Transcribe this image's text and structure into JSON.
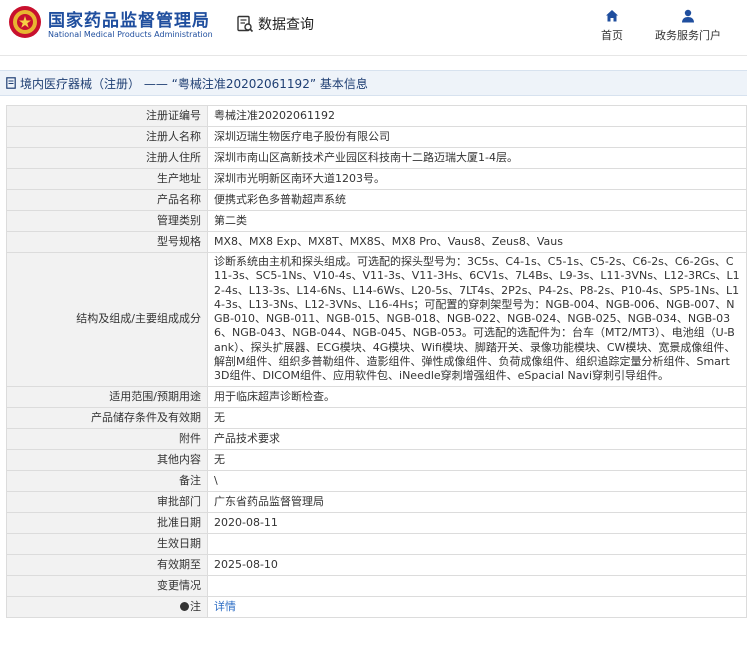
{
  "site": {
    "name_cn": "国家药品监督管理局",
    "name_en": "National Medical Products Administration",
    "query_label": "数据查询",
    "nav_home": "首页",
    "nav_gov": "政务服务门户"
  },
  "breadcrumb": "境内医疗器械（注册） —— “粤械注准20202061192” 基本信息",
  "rows": [
    {
      "label": "注册证编号",
      "value": "粤械注准20202061192"
    },
    {
      "label": "注册人名称",
      "value": "深圳迈瑞生物医疗电子股份有限公司"
    },
    {
      "label": "注册人住所",
      "value": "深圳市南山区高新技术产业园区科技南十二路迈瑞大厦1-4层。"
    },
    {
      "label": "生产地址",
      "value": "深圳市光明新区南环大道1203号。"
    },
    {
      "label": "产品名称",
      "value": "便携式彩色多普勒超声系统"
    },
    {
      "label": "管理类别",
      "value": "第二类"
    },
    {
      "label": "型号规格",
      "value": "MX8、MX8 Exp、MX8T、MX8S、MX8 Pro、Vaus8、Zeus8、Vaus"
    },
    {
      "label": "结构及组成/主要组成成分",
      "value": "诊断系统由主机和探头组成。可选配的探头型号为：3C5s、C4-1s、C5-1s、C5-2s、C6-2s、C6-2Gs、C11-3s、SC5-1Ns、V10-4s、V11-3s、V11-3Hs、6CV1s、7L4Bs、L9-3s、L11-3VNs、L12-3RCs、L12-4s、L13-3s、L14-6Ns、L14-6Ws、L20-5s、7LT4s、2P2s、P4-2s、P8-2s、P10-4s、SP5-1Ns、L14-3s、L13-3Ns、L12-3VNs、L16-4Hs；可配置的穿刺架型号为：NGB-004、NGB-006、NGB-007、NGB-010、NGB-011、NGB-015、NGB-018、NGB-022、NGB-024、NGB-025、NGB-034、NGB-036、NGB-043、NGB-044、NGB-045、NGB-053。可选配的选配件为：台车（MT2/MT3）、电池组（U-Bank）、探头扩展器、ECG模块、4G模块、Wifi模块、脚踏开关、录像功能模块、CW模块、宽景成像组件、解剖M组件、组织多普勒组件、造影组件、弹性成像组件、负荷成像组件、组织追踪定量分析组件、Smart 3D组件、DICOM组件、应用软件包、iNeedle穿刺增强组件、eSpacial Navi穿刺引导组件。"
    },
    {
      "label": "适用范围/预期用途",
      "value": "用于临床超声诊断检查。"
    },
    {
      "label": "产品储存条件及有效期",
      "value": "无"
    },
    {
      "label": "附件",
      "value": "产品技术要求"
    },
    {
      "label": "其他内容",
      "value": "无"
    },
    {
      "label": "备注",
      "value": "\\"
    },
    {
      "label": "审批部门",
      "value": "广东省药品监督管理局"
    },
    {
      "label": "批准日期",
      "value": "2020-08-11"
    },
    {
      "label": "生效日期",
      "value": ""
    },
    {
      "label": "有效期至",
      "value": "2025-08-10"
    },
    {
      "label": "变更情况",
      "value": ""
    },
    {
      "label": "注",
      "value": "详情"
    }
  ],
  "colors": {
    "brand": "#1f4e9e",
    "label_bg": "#f2f2f2",
    "link": "#2b6cc4"
  }
}
